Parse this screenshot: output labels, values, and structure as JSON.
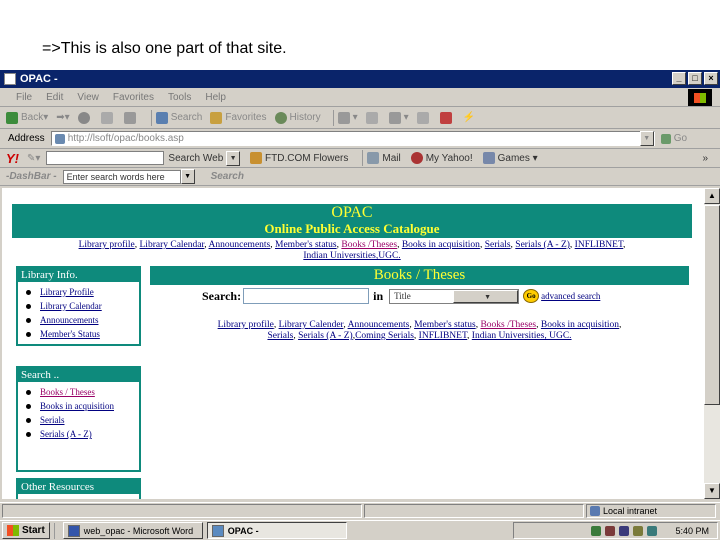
{
  "caption": "=>This is also one part of that site.",
  "window": {
    "title": "OPAC -"
  },
  "menu": {
    "items": [
      "File",
      "Edit",
      "View",
      "Favorites",
      "Tools",
      "Help"
    ]
  },
  "toolbar": {
    "back": "Back",
    "search": "Search",
    "favorites": "Favorites",
    "history": "History"
  },
  "address": {
    "label": "Address",
    "value": "http://lsoft/opac/books.asp",
    "go": "Go"
  },
  "yahoo": {
    "logo": "Y!",
    "search_web": "Search Web",
    "ftd": "FTD.COM Flowers",
    "mail": "Mail",
    "my_yahoo": "My Yahoo!",
    "games": "Games"
  },
  "dashbar": {
    "logo": "-DashBar -",
    "placeholder": "Enter search words here",
    "search": "Search"
  },
  "page": {
    "banner_title": "OPAC",
    "banner_subtitle": "Online Public Access Catalogue",
    "top_links": [
      "Library profile",
      "Library Calendar",
      "Announcements",
      "Member's status",
      "Books /Theses",
      "Books in acquisition",
      "Serials",
      "Serials (A - Z)",
      "INFLIBNET",
      "Indian Universities,UGC."
    ],
    "library_info": {
      "heading": "Library Info.",
      "items": [
        "Library Profile",
        "Library Calendar",
        "Announcements",
        "Member's Status"
      ]
    },
    "search_panel": {
      "heading": "Search ..",
      "items": [
        "Books / Theses",
        "Books in acquisition",
        "Serials",
        "Serials (A - Z)"
      ]
    },
    "other": {
      "heading": "Other Resources"
    },
    "books_heading": "Books / Theses",
    "search_label": "Search:",
    "in_label": "in",
    "field_selected": "Title",
    "go": "Go",
    "advanced": "advanced search",
    "mid_links": [
      "Library profile",
      "Library Calender",
      "Announcements",
      "Member's status",
      "Books /Theses",
      "Books in acquisition",
      "Serials",
      "Serials (A - Z)",
      "Coming Serials",
      "INFLIBNET",
      "Indian Universities, UGC."
    ]
  },
  "status": {
    "zone": "Local intranet"
  },
  "taskbar": {
    "start": "Start",
    "task1": "web_opac - Microsoft Word",
    "task2": "OPAC -",
    "clock": "5:40 PM"
  },
  "colors": {
    "teal": "#0e8a7c",
    "yellow": "#ffff33",
    "link": "#000080",
    "link_selected": "#990066"
  }
}
